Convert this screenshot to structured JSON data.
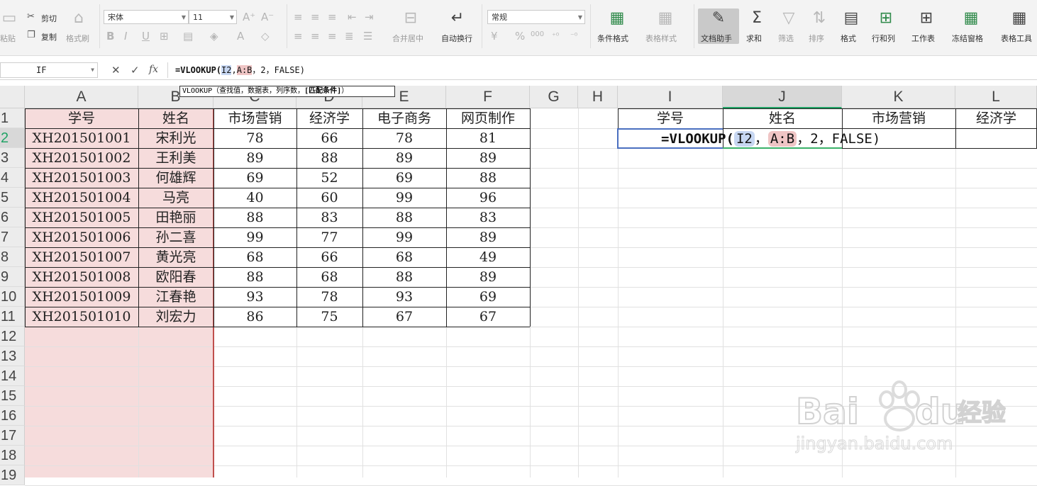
{
  "ribbon": {
    "clipboard": {
      "paste": "粘贴",
      "cut": "剪切",
      "copy": "复制",
      "format_painter": "格式刷"
    },
    "font": {
      "name": "宋体",
      "size": "11",
      "bold": "B",
      "italic": "I",
      "underline": "U",
      "font_color": "A"
    },
    "alignment": {
      "merge_center": "合并居中",
      "wrap_text": "自动换行"
    },
    "number": {
      "format": "常规",
      "percent": "%",
      "thousands": "000"
    },
    "styles": {
      "conditional_format": "条件格式",
      "table_style": "表格样式"
    },
    "doc_assistant": "文档助手",
    "sum": "求和",
    "filter": "筛选",
    "sort": "排序",
    "format": "格式",
    "rows_cols": "行和列",
    "worksheet": "工作表",
    "freeze": "冻结窗格",
    "table_tools": "表格工具"
  },
  "formula_bar": {
    "name_box": "IF",
    "fx": "fx",
    "formula_prefix": "=VLOOKUP(",
    "ref_lookup": "I2",
    "sep1": ",",
    "ref_table": "A:B",
    "rest": "，2，FALSE)"
  },
  "tooltip": {
    "fn": "VLOOKUP",
    "args": "（查找值，数据表，列序数，",
    "opt": "[匹配条件]",
    "close": "）"
  },
  "columns": [
    "A",
    "B",
    "C",
    "D",
    "E",
    "F",
    "G",
    "H",
    "I",
    "J",
    "K",
    "L"
  ],
  "rows": [
    "1",
    "2",
    "3",
    "4",
    "5",
    "6",
    "7",
    "8",
    "9",
    "10",
    "11",
    "12",
    "13",
    "14",
    "15",
    "16",
    "17",
    "18",
    "19"
  ],
  "table": {
    "headers": [
      "学号",
      "姓名",
      "市场营销",
      "经济学",
      "电子商务",
      "网页制作"
    ],
    "rows": [
      [
        "XH201501001",
        "宋利光",
        "78",
        "66",
        "78",
        "81"
      ],
      [
        "XH201501002",
        "王利美",
        "89",
        "88",
        "89",
        "89"
      ],
      [
        "XH201501003",
        "何雄辉",
        "69",
        "52",
        "69",
        "88"
      ],
      [
        "XH201501004",
        "马亮",
        "40",
        "60",
        "99",
        "96"
      ],
      [
        "XH201501005",
        "田艳丽",
        "88",
        "83",
        "88",
        "83"
      ],
      [
        "XH201501006",
        "孙二喜",
        "99",
        "77",
        "99",
        "89"
      ],
      [
        "XH201501007",
        "黄光亮",
        "68",
        "66",
        "68",
        "49"
      ],
      [
        "XH201501008",
        "欧阳春",
        "88",
        "68",
        "88",
        "89"
      ],
      [
        "XH201501009",
        "江春艳",
        "93",
        "78",
        "93",
        "69"
      ],
      [
        "XH201501010",
        "刘宏力",
        "86",
        "75",
        "67",
        "67"
      ]
    ]
  },
  "lookup_table": {
    "headers": [
      "学号",
      "姓名",
      "市场营销",
      "经济学"
    ],
    "editing": {
      "prefix": "=VLOOKUP(",
      "ref_lookup": "I2",
      "sep1": "，",
      "ref_table": "A:B",
      "rest": "，2，FALSE)"
    }
  },
  "watermark": {
    "brand": "Bai",
    "brand2": "du",
    "product": "经验",
    "url": "jingyan.baidu.com"
  },
  "colors": {
    "pink_fill": "#f6dcdc",
    "accent_green": "#21a366",
    "ref_blue": "#c7d7f2",
    "ref_red": "#efc5c5"
  }
}
